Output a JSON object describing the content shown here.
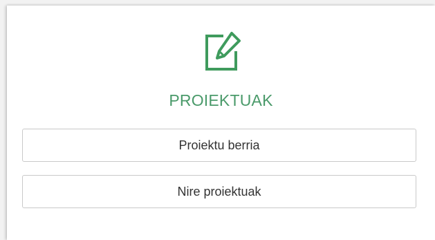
{
  "panel": {
    "icon": "edit-document-icon",
    "title": "PROIEKTUAK",
    "accent_color": "#4a9a6a"
  },
  "buttons": {
    "new_project": "Proiektu berria",
    "my_projects": "Nire proiektuak"
  }
}
